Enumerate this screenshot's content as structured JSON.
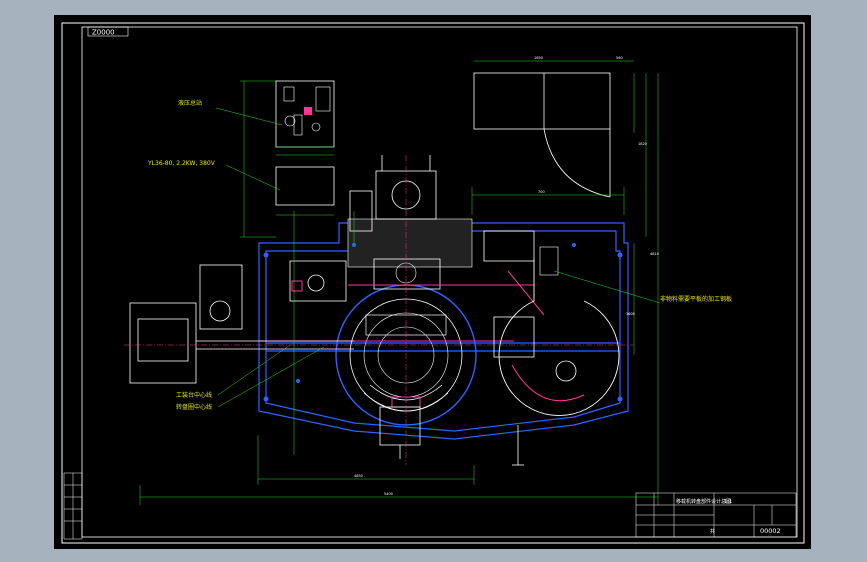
{
  "drawing": {
    "stamp_top_left": "Z0000",
    "drawing_number": "00002",
    "title_block_text": "移载机转盘部件设计总图",
    "title_block_scale": "1:1",
    "sheet_label": "共",
    "colors": {
      "background": "#000000",
      "frame": "#ffffff",
      "machine": "#2f62ff",
      "dimension": "#22dd22",
      "accent": "#ff3399",
      "label": "#e6e600"
    }
  },
  "labels": {
    "top_part": "液压总站",
    "motor_spec": "YL36-80, 2.2KW, 380V",
    "right_note": "非物料需要平板的加工钢板",
    "center_axis_1": "工装台中心线",
    "center_axis_2": "转盘圈中心线"
  },
  "dims": {
    "d_top_right": "1650",
    "d_top_right_small": "560",
    "d_vert_1": "1820",
    "d_vert_2": "4810",
    "d_vert_3": "1600",
    "d_bottom": "4850",
    "d_mid": "700",
    "d_left": "5400"
  }
}
